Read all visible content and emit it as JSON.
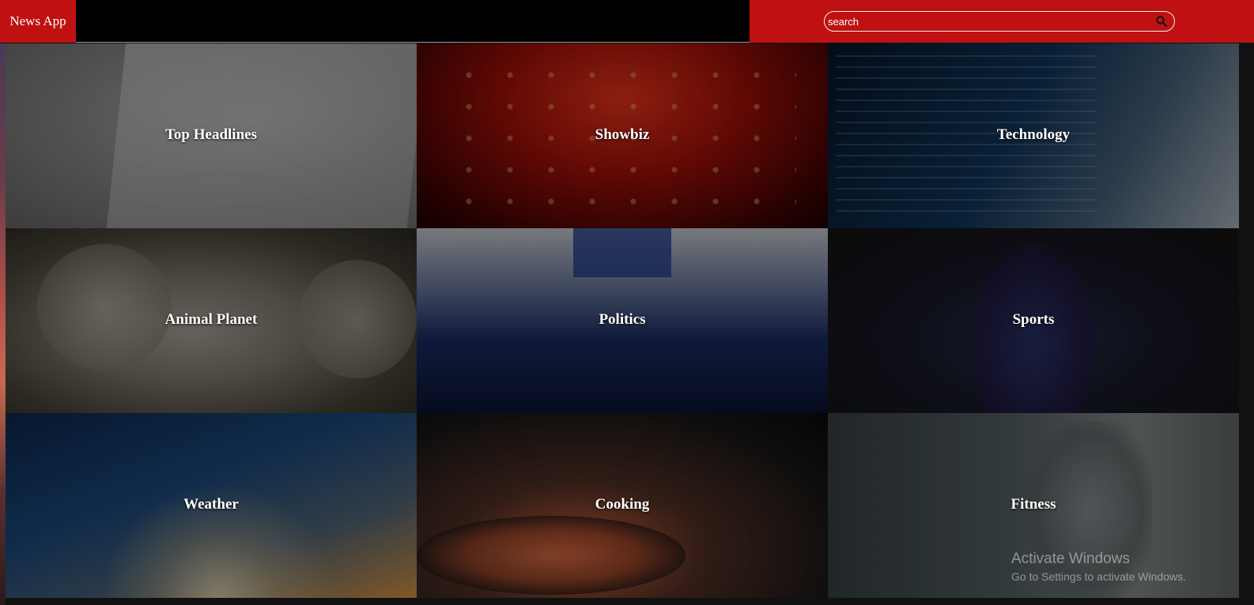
{
  "navbar": {
    "brand": "News App",
    "search": {
      "placeholder": "search",
      "value": "",
      "icon": "search-icon"
    }
  },
  "colors": {
    "brand_red": "#bf1111",
    "nav_bg": "#000000",
    "label_text": "#ffffff"
  },
  "categories": [
    {
      "label": "Top Headlines",
      "image": "newspaper-mockup"
    },
    {
      "label": "Showbiz",
      "image": "theater-lights"
    },
    {
      "label": "Technology",
      "image": "laptop-code"
    },
    {
      "label": "Animal Planet",
      "image": "koala"
    },
    {
      "label": "Politics",
      "image": "eu-parliament"
    },
    {
      "label": "Sports",
      "image": "football-player"
    },
    {
      "label": "Weather",
      "image": "sunrise-clouds"
    },
    {
      "label": "Cooking",
      "image": "cooking-pan"
    },
    {
      "label": "Fitness",
      "image": "gym-athlete"
    }
  ],
  "watermark": {
    "title": "Activate Windows",
    "subtitle": "Go to Settings to activate Windows."
  }
}
